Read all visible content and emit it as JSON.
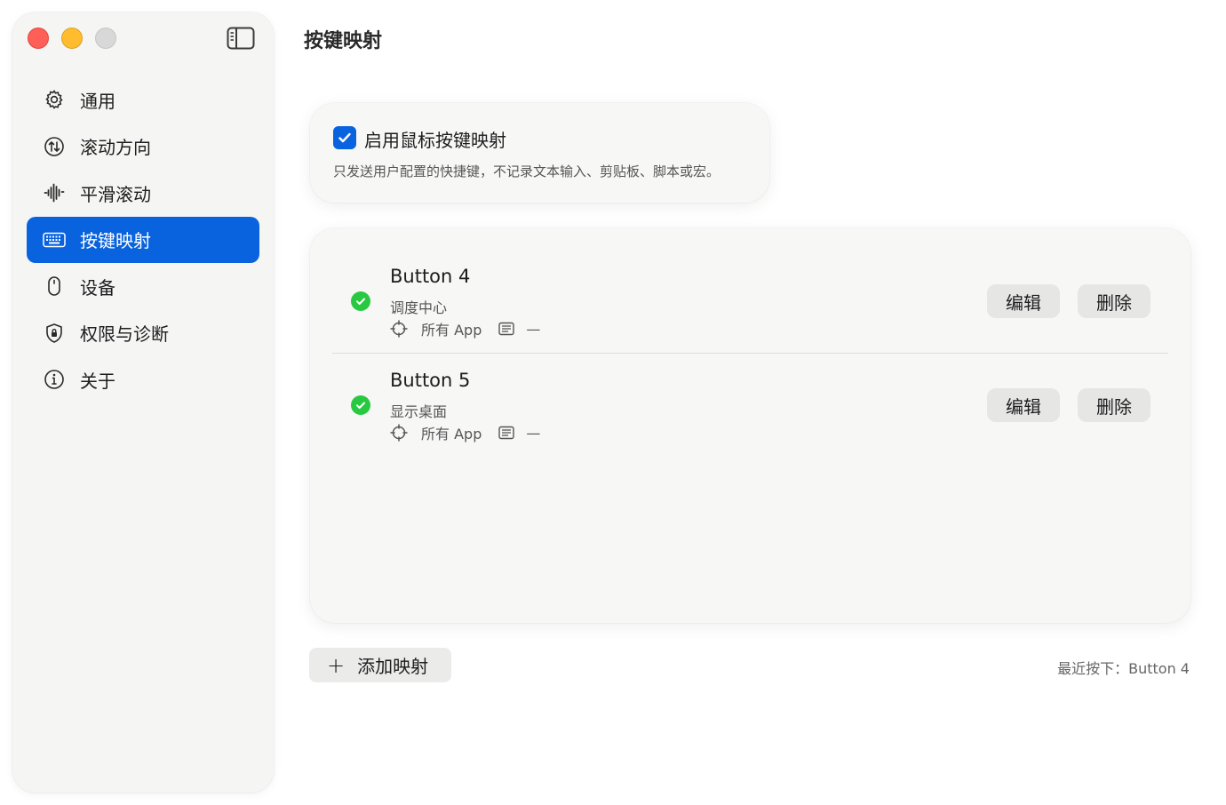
{
  "window": {
    "traffic_lights": [
      "close",
      "minimize",
      "zoom"
    ],
    "toggle_sidebar_icon": "sidebar-left-icon"
  },
  "sidebar": {
    "items": [
      {
        "label": "通用",
        "icon": "gear-icon"
      },
      {
        "label": "滚动方向",
        "icon": "scroll-direction-icon"
      },
      {
        "label": "平滑滚动",
        "icon": "waveform-icon"
      },
      {
        "label": "按键映射",
        "icon": "keyboard-icon",
        "active": true
      },
      {
        "label": "设备",
        "icon": "mouse-icon"
      },
      {
        "label": "权限与诊断",
        "icon": "shield-lock-icon"
      },
      {
        "label": "关于",
        "icon": "info-icon"
      }
    ]
  },
  "main": {
    "title": "按键映射",
    "enable": {
      "checked": true,
      "label": "启用鼠标按键映射",
      "description": "只发送用户配置的快捷键，不记录文本输入、剪贴板、脚本或宏。"
    },
    "mappings": [
      {
        "button": "Button 4",
        "action": "调度中心",
        "scope": "所有 App",
        "shortcut": "—",
        "enabled": true,
        "edit_label": "编辑",
        "delete_label": "删除"
      },
      {
        "button": "Button 5",
        "action": "显示桌面",
        "scope": "所有 App",
        "shortcut": "—",
        "enabled": true,
        "edit_label": "编辑",
        "delete_label": "删除"
      }
    ],
    "add_button": {
      "plus": "+",
      "label": "添加映射"
    },
    "last_pressed": "最近按下：Button 4"
  },
  "colors": {
    "accent": "#0a63de",
    "status_ok": "#28c940",
    "close": "#fe5f57",
    "minimize": "#febc2e",
    "zoom_disabled": "#d8d8d8"
  }
}
